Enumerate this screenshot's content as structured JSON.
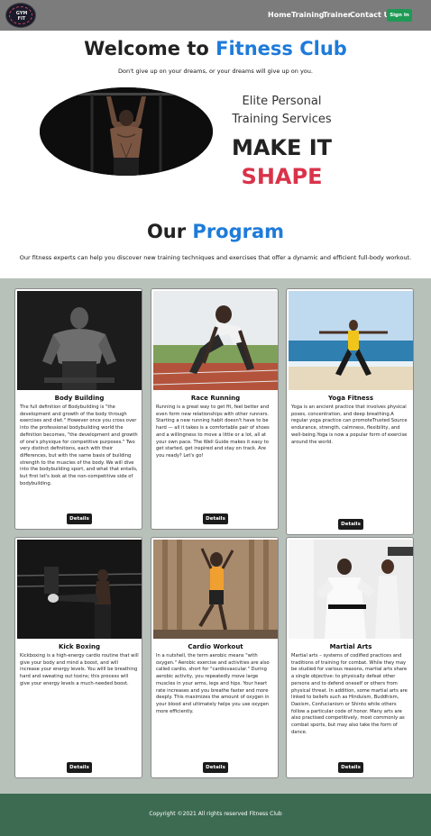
{
  "nav": {
    "logo_text": "GYM\nFIT",
    "links": [
      "Home",
      "Training",
      "Trainer",
      "Contact Us"
    ],
    "signin_label": "Sign In"
  },
  "hero": {
    "title_prefix": "Welcome to ",
    "title_accent": "Fitness Club",
    "subtitle": "Don't give up on your dreams, or your dreams will give up on you.",
    "elite": "Elite Personal Training Services",
    "make_it": "MAKE IT",
    "shape": "SHAPE"
  },
  "program": {
    "title_prefix": "Our ",
    "title_accent": "Program",
    "subtitle": "Our fitness experts can help you discover new training techniques and exercises that offer a dynamic and efficient full-body workout."
  },
  "cards": [
    {
      "title": "Body Building",
      "text": "The full definition of Bodybuilding is \"the development and growth of the body through exercises and diet.\" However once you cross over into the professional bodybuilding world the definition becomes, \"the development and growth of one's physique for competitive purposes.\" Two very distinct definitions, each with their differences, but with the same basis of building strength to the muscles of the body. We will dive into the bodybuilding sport, and what that entails, but first let's look at the non-competitive side of bodybuilding.",
      "button": "Details"
    },
    {
      "title": "Race Running",
      "text": "Running is a great way to get fit, feel better and even form new relationships with other runners. Starting a new running habit doesn't have to be hard — all it takes is a comfortable pair of shoes and a willingness to move a little or a lot, all at your own pace. The Well Guide makes it easy to get started, get inspired and stay on track. Are you ready? Let's go!",
      "button": "Details"
    },
    {
      "title": "Yoga Fitness",
      "text": "Yoga is an ancient practice that involves physical poses, concentration, and deep breathing.A regular yoga practice can promoteTrusted Source endurance, strength, calmness, flexibility, and well-being.Yoga is now a popular form of exercise around the world.",
      "button": "Details"
    },
    {
      "title": "Kick Boxing",
      "text": "Kickboxing is a high-energy cardio routine that will give your body and mind a boost, and will increase your energy levels. You willl be breathing hard and sweating out toxins; this process will give your energy levels a much-needed boost.",
      "button": "Details"
    },
    {
      "title": "Cardio Workout",
      "text": "In a nutshell, the term aerobic means \"with oxygen.\" Aerobic exercise and activities are also called cardio, short for \"cardiovascular.\" During aerobic activity, you repeatedly move large muscles in your arms, legs and hips. Your heart rate increases and you breathe faster and more deeply. This maximizes the amount of oxygen in your blood and ultimately helps you use oxygen more efficiently.",
      "button": "Details"
    },
    {
      "title": "Martial Arts",
      "text": "Martial arts – systems of codified practices and traditions of training for combat. While they may be studied for various reasons, martial arts share a single objective: to physically defeat other persons and to defend oneself or others from physical threat. In addition, some martial arts are linked to beliefs such as Hinduism, Buddhism, Daoism, Confucianism or Shinto while others follow a particular code of honor. Many arts are also practised competitively, most commonly as combat sports, but may also take the form of dance.",
      "button": "Details"
    }
  ],
  "footer": {
    "text": "Copyright ©2021 All rights reserved Fitness Club"
  }
}
